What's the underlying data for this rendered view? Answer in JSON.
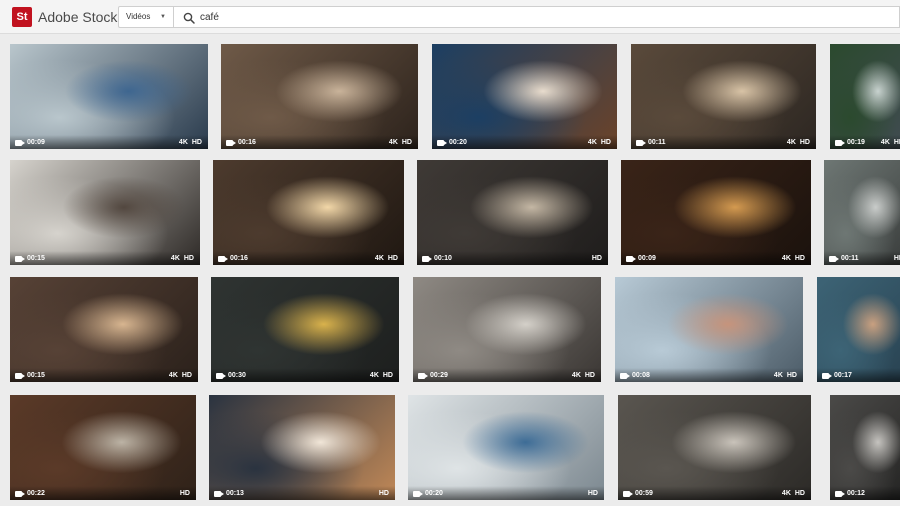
{
  "app": {
    "logo_text": "St",
    "brand": "Adobe Stock"
  },
  "search": {
    "type_value": "Vidéos",
    "query": "café"
  },
  "icons": {
    "logo": "adobe-stock-logo",
    "chevron": "chevron-down-icon",
    "search": "search-icon",
    "video": "video-camera-icon"
  },
  "rows": [
    [
      {
        "duration": "00:09",
        "k4": "4K",
        "hd": "HD",
        "palette": [
          "#b9c6cc",
          "#3e6690",
          "#2a3b4d"
        ]
      },
      {
        "duration": "00:16",
        "k4": "4K",
        "hd": "HD",
        "palette": [
          "#6f5a48",
          "#c9b39a",
          "#2d231c"
        ]
      },
      {
        "duration": "00:20",
        "k4": "4K",
        "hd": "HD",
        "palette": [
          "#1c3f63",
          "#e8dccd",
          "#6b4329"
        ]
      },
      {
        "duration": "00:11",
        "k4": "4K",
        "hd": "HD",
        "palette": [
          "#5a4a3b",
          "#d8c3a6",
          "#2d2722"
        ]
      },
      {
        "duration": "00:19",
        "k4": "4K",
        "hd": "HD",
        "palette": [
          "#2b4a2e",
          "#c8d2cf",
          "#414b52"
        ]
      }
    ],
    [
      {
        "duration": "00:15",
        "k4": "4K",
        "hd": "HD",
        "palette": [
          "#d6d3cd",
          "#52473f",
          "#2e2a27"
        ]
      },
      {
        "duration": "00:16",
        "k4": "4K",
        "hd": "HD",
        "palette": [
          "#4d3b2e",
          "#f2d7a8",
          "#201812"
        ]
      },
      {
        "duration": "00:10",
        "k4": "",
        "hd": "HD",
        "palette": [
          "#3f3a36",
          "#c4b7a4",
          "#1f1d1c"
        ]
      },
      {
        "duration": "00:09",
        "k4": "4K",
        "hd": "HD",
        "palette": [
          "#3a2418",
          "#d49a50",
          "#1b120d"
        ]
      },
      {
        "duration": "00:11",
        "k4": "",
        "hd": "HD",
        "palette": [
          "#6e7774",
          "#c9ccca",
          "#383b3a"
        ]
      }
    ],
    [
      {
        "duration": "00:15",
        "k4": "4K",
        "hd": "HD",
        "palette": [
          "#574236",
          "#d7b590",
          "#2b211b"
        ]
      },
      {
        "duration": "00:30",
        "k4": "4K",
        "hd": "HD",
        "palette": [
          "#2f3432",
          "#d9b24c",
          "#1d1f1e"
        ]
      },
      {
        "duration": "00:29",
        "k4": "4K",
        "hd": "HD",
        "palette": [
          "#8f8a84",
          "#d4d0c9",
          "#3b3734"
        ]
      },
      {
        "duration": "00:08",
        "k4": "4K",
        "hd": "HD",
        "palette": [
          "#b8cad6",
          "#c6947c",
          "#4c5c68"
        ]
      },
      {
        "duration": "00:17",
        "k4": "",
        "hd": "",
        "palette": [
          "#3d6476",
          "#c9a080",
          "#284150"
        ]
      }
    ],
    [
      {
        "duration": "00:22",
        "k4": "",
        "hd": "HD",
        "palette": [
          "#5b3a28",
          "#bcb3a5",
          "#2f2219"
        ]
      },
      {
        "duration": "00:13",
        "k4": "",
        "hd": "HD",
        "palette": [
          "#2a3340",
          "#f1e6d8",
          "#c08857"
        ]
      },
      {
        "duration": "00:20",
        "k4": "",
        "hd": "HD",
        "palette": [
          "#dfe4e6",
          "#3d6c96",
          "#7c8890"
        ]
      },
      {
        "duration": "00:59",
        "k4": "4K",
        "hd": "HD",
        "palette": [
          "#5a5650",
          "#c9c3ba",
          "#2c2a27"
        ]
      },
      {
        "duration": "00:12",
        "k4": "",
        "hd": "",
        "palette": [
          "#4b4a48",
          "#c5c3bf",
          "#232322"
        ]
      }
    ]
  ]
}
